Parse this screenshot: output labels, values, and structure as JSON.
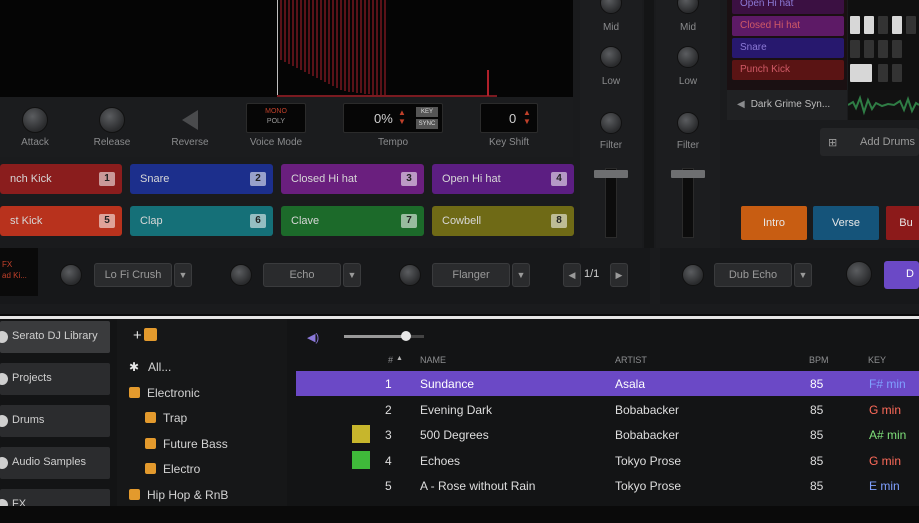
{
  "deck": {
    "controls": {
      "attack": "Attack",
      "release": "Release",
      "reverse": "Reverse",
      "voice_mode": "Voice Mode",
      "voice_mode_value_top": "MONO",
      "voice_mode_value_bottom": "POLY",
      "tempo": "Tempo",
      "tempo_value": "0%",
      "tempo_badge_top": "KEY",
      "tempo_badge_bottom": "SYNC",
      "key_shift": "Key Shift",
      "key_shift_value": "0"
    },
    "pads": [
      {
        "label": "nch Kick",
        "num": "1",
        "color": "#8a1d1d"
      },
      {
        "label": "Snare",
        "num": "2",
        "color": "#1c2f8c"
      },
      {
        "label": "Closed Hi hat",
        "num": "3",
        "color": "#6a1f7e"
      },
      {
        "label": "Open Hi hat",
        "num": "4",
        "color": "#5c1e82"
      },
      {
        "label": "st Kick",
        "num": "5",
        "color": "#b8321d"
      },
      {
        "label": "Clap",
        "num": "6",
        "color": "#157078"
      },
      {
        "label": "Clave",
        "num": "7",
        "color": "#1c6a2a"
      },
      {
        "label": "Cowbell",
        "num": "8",
        "color": "#6f6a16"
      }
    ],
    "fx": {
      "left_label_a": "FX",
      "left_label_b": "ad Ki...",
      "fx1": "Lo Fi Crush",
      "fx2": "Echo",
      "fx3": "Flanger",
      "beat": "1/1",
      "fx4": "Dub Echo"
    }
  },
  "mixer": {
    "mid": "Mid",
    "low": "Low",
    "filter": "Filter"
  },
  "drums": {
    "lanes": [
      {
        "label": "Open Hi hat",
        "color": "#3b1042"
      },
      {
        "label": "Closed Hi hat",
        "color": "#5d1a66"
      },
      {
        "label": "Snare",
        "color": "#27186e"
      },
      {
        "label": "Punch Kick",
        "color": "#5a1414"
      }
    ],
    "sample": "Dark Grime Syn...",
    "add_drums": "Add Drums",
    "cues": [
      {
        "label": "Intro",
        "color": "#c85d12"
      },
      {
        "label": "Verse",
        "color": "#15547a"
      },
      {
        "label": "Bu",
        "color": "#8c1a1a"
      }
    ],
    "right_btn": "D"
  },
  "library": {
    "sidebar": [
      "Serato DJ Library",
      "Projects",
      "Drums",
      "Audio Samples",
      "FX"
    ],
    "tree": [
      {
        "label": "All...",
        "indent": 0,
        "icon": "all"
      },
      {
        "label": "Electronic",
        "indent": 0,
        "icon": "folder"
      },
      {
        "label": "Trap",
        "indent": 1,
        "icon": "folder"
      },
      {
        "label": "Future Bass",
        "indent": 1,
        "icon": "folder"
      },
      {
        "label": "Electro",
        "indent": 1,
        "icon": "folder"
      },
      {
        "label": "Hip Hop & RnB",
        "indent": 0,
        "icon": "folder"
      }
    ],
    "columns": {
      "num": "#",
      "name": "NAME",
      "artist": "ARTIST",
      "bpm": "BPM",
      "key": "KEY"
    },
    "tracks": [
      {
        "num": "1",
        "name": "Sundance",
        "artist": "Asala",
        "bpm": "85",
        "key": "F# min",
        "key_color": "#7fa0ff",
        "swatch": "",
        "selected": true
      },
      {
        "num": "2",
        "name": "Evening Dark",
        "artist": "Bobabacker",
        "bpm": "85",
        "key": "G min",
        "key_color": "#ff6b5a",
        "swatch": "",
        "selected": false
      },
      {
        "num": "3",
        "name": "500 Degrees",
        "artist": "Bobabacker",
        "bpm": "85",
        "key": "A# min",
        "key_color": "#7fe07a",
        "swatch": "#c7b62c",
        "selected": false
      },
      {
        "num": "4",
        "name": "Echoes",
        "artist": "Tokyo Prose",
        "bpm": "85",
        "key": "G min",
        "key_color": "#ff6b5a",
        "swatch": "#3fba3a",
        "selected": false
      },
      {
        "num": "5",
        "name": "A - Rose without Rain",
        "artist": "Tokyo Prose",
        "bpm": "85",
        "key": "E min",
        "key_color": "#7fa0ff",
        "swatch": "",
        "selected": false
      }
    ]
  },
  "colors": {
    "accent": "#6b49c6",
    "folder": "#e39a2d"
  }
}
